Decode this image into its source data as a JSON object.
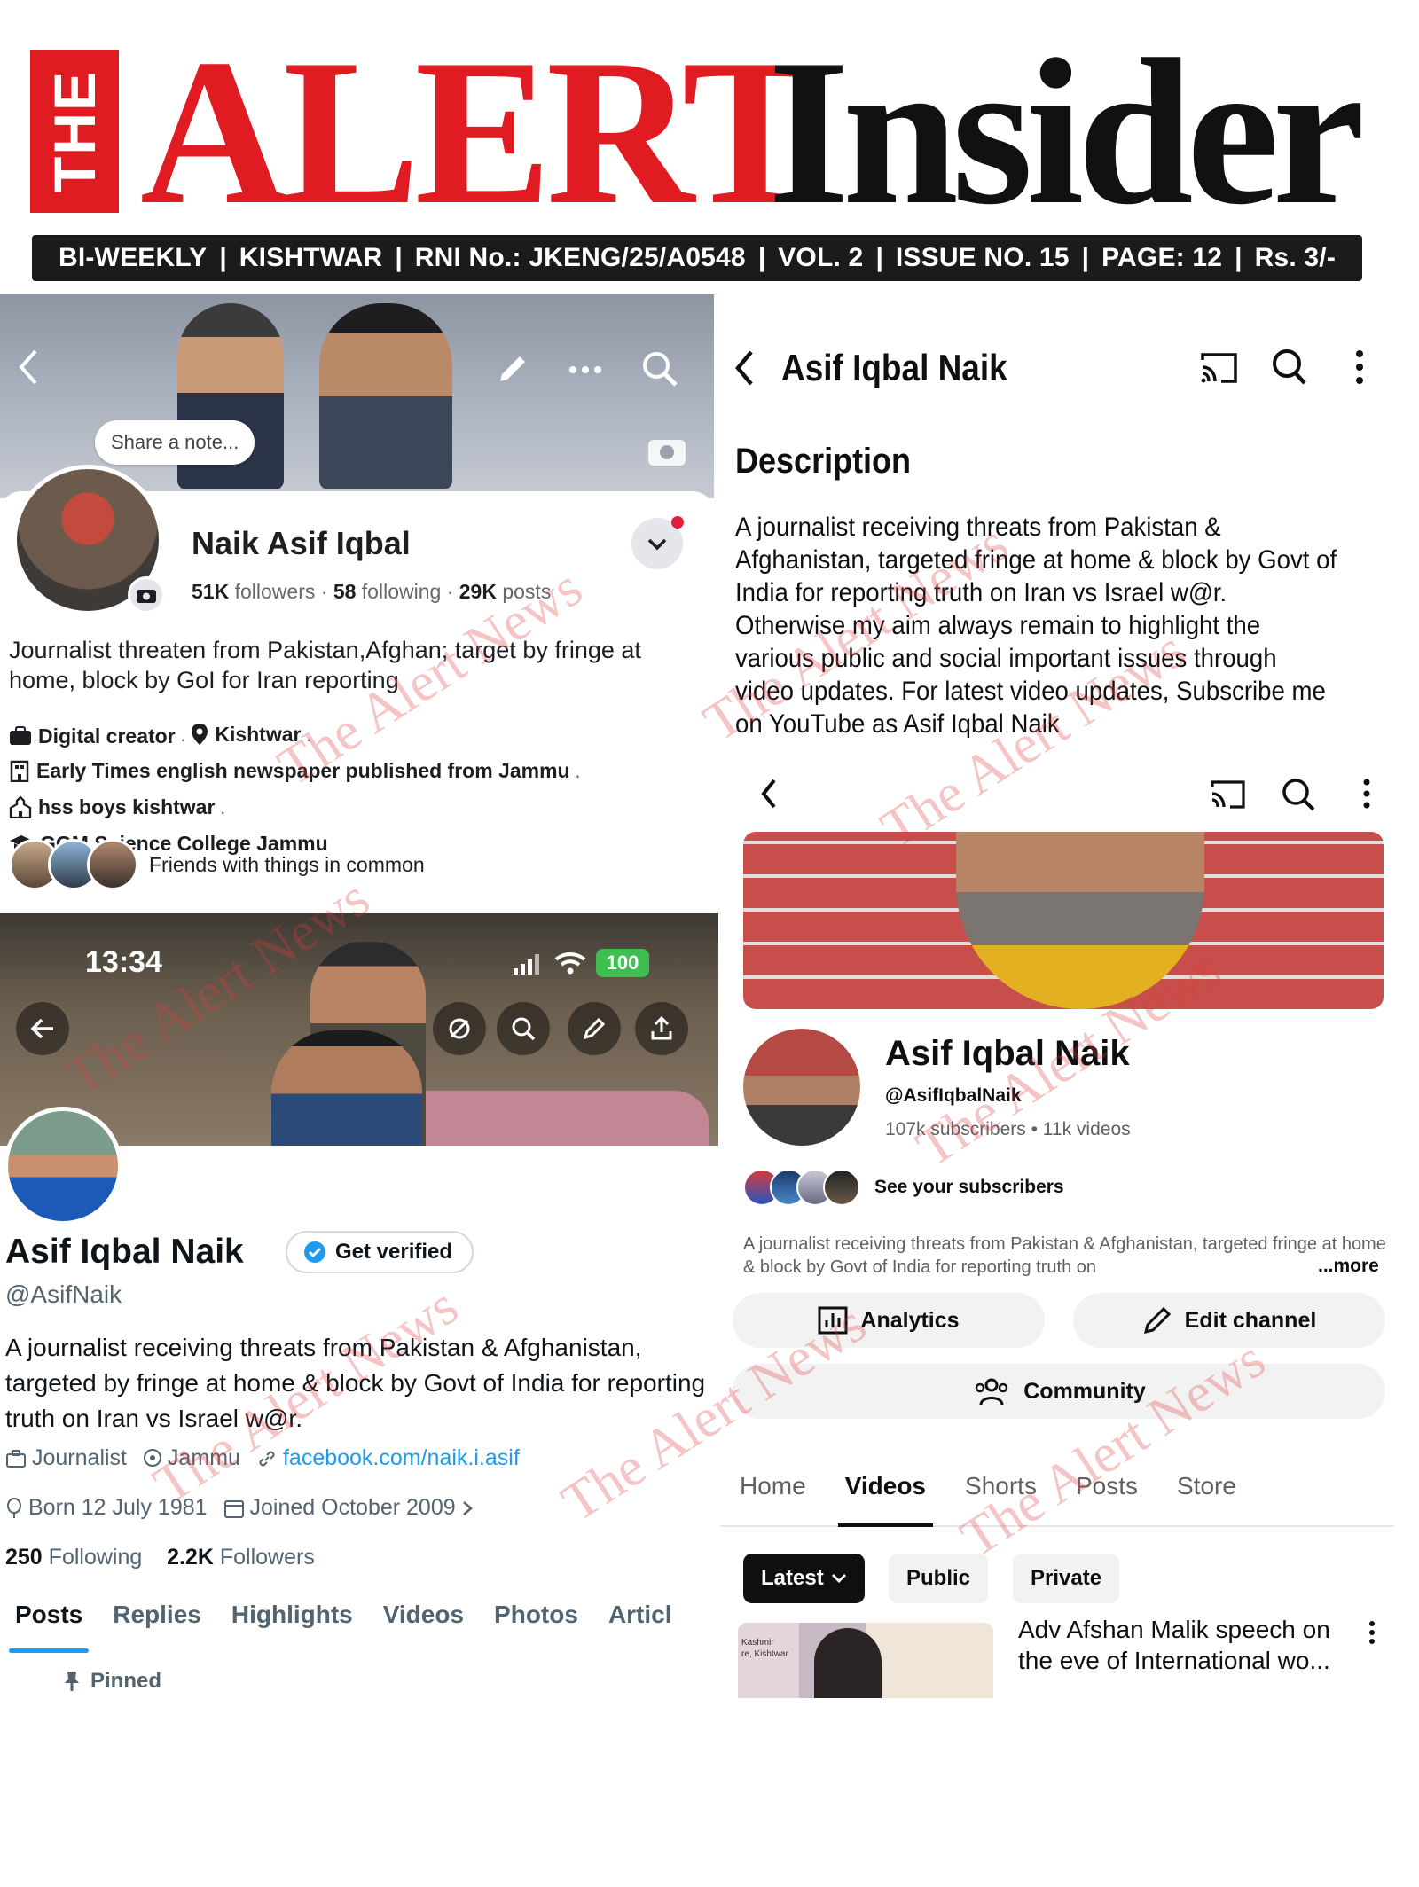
{
  "masthead": {
    "the": "THE",
    "alert": "ALERT",
    "insider": "Insider",
    "info_items": [
      "BI-WEEKLY",
      "KISHTWAR",
      "RNI No.: JKENG/25/A0548",
      "VOL. 2",
      "ISSUE NO. 15",
      "PAGE: 12",
      "Rs. 3/-"
    ],
    "separator": "|",
    "brand_red": "#e01b22"
  },
  "facebook": {
    "note_placeholder": "Share a note...",
    "name": "Naik Asif Iqbal",
    "followers_count": "51K",
    "followers_label": "followers",
    "following_count": "58",
    "following_label": "following",
    "posts_count": "29K",
    "posts_label": "posts",
    "stats_sep": "·",
    "bio": "Journalist threaten from Pakistan,Afghan; target by fringe at home, block by GoI for Iran reporting",
    "details": {
      "d1": "Digital creator",
      "d2": "Kishtwar",
      "d3": "Early Times english newspaper published from Jammu",
      "d4": "hss boys kishtwar",
      "d5": "GGM Science College Jammu",
      "sep": "·"
    },
    "friends_label": "Friends with things in common",
    "icons": [
      "back-icon",
      "pencil-icon",
      "more-icon",
      "search-icon",
      "camera-icon",
      "chevron-down-icon"
    ]
  },
  "twitter": {
    "status_time": "13:34",
    "battery": "100",
    "name": "Asif Iqbal Naik",
    "verify_label": "Get verified",
    "handle": "@AsifNaik",
    "bio": "A journalist receiving threats from Pakistan & Afghanistan, targeted by fringe at home & block by Govt of India for reporting truth on Iran vs Israel w@r.",
    "profession": "Journalist",
    "location": "Jammu",
    "link": "facebook.com/naik.i.asif",
    "born": "Born 12 July 1981",
    "joined": "Joined October 2009",
    "following_count": "250",
    "following_label": "Following",
    "followers_count": "2.2K",
    "followers_label": "Followers",
    "tabs": [
      "Posts",
      "Replies",
      "Highlights",
      "Videos",
      "Photos",
      "Articl"
    ],
    "pinned_label": "Pinned",
    "accent": "#1d9bf0"
  },
  "youtube_description": {
    "title": "Asif Iqbal Naik",
    "heading": "Description",
    "text_1": "A journalist receiving threats from Pakistan & Afghanistan, targeted fringe at home & block by Govt of India for reporting truth on Iran vs Israel w@r.",
    "text_2": "Otherwise my aim always remain to highlight the various public and social important issues through video updates. For latest video updates, Subscribe me on YouTube as Asif Iqbal Naik"
  },
  "youtube_channel": {
    "name": "Asif Iqbal Naik",
    "handle": "@AsifIqbalNaik",
    "subscribers": "107k subscribers",
    "videos": "11k videos",
    "stats_sep": "•",
    "see_subscribers": "See your subscribers",
    "about": "A journalist receiving threats from Pakistan & Afghanistan, targeted fringe at home & block by Govt of India for reporting truth on",
    "more_label": "...more",
    "analytics_label": "Analytics",
    "edit_label": "Edit channel",
    "community_label": "Community",
    "tabs": [
      "Home",
      "Videos",
      "Shorts",
      "Posts",
      "Store"
    ],
    "chips": [
      "Latest",
      "Public",
      "Private"
    ],
    "video_title": "Adv Afshan Malik speech on the eve of International wo...",
    "thumb_caption": "Kashmir\nre, Kishtwar"
  },
  "watermark": "The Alert News"
}
